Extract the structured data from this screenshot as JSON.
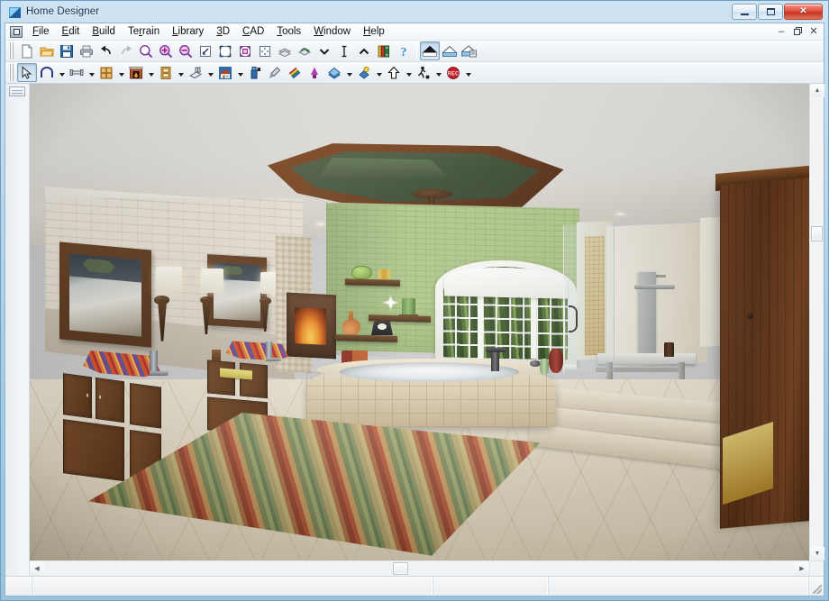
{
  "window": {
    "title": "Home Designer",
    "app_icon": "app-logo-icon",
    "controls": {
      "minimize": "–",
      "maximize": "❑",
      "close": "✕"
    },
    "mdi_controls": {
      "minimize": "–",
      "restore": "❐",
      "close": "✕"
    }
  },
  "menubar": {
    "system_icon": "system-menu-icon",
    "items": [
      {
        "label": "File",
        "accel": "F"
      },
      {
        "label": "Edit",
        "accel": "E"
      },
      {
        "label": "Build",
        "accel": "B"
      },
      {
        "label": "Terrain",
        "accel": "r"
      },
      {
        "label": "Library",
        "accel": "L"
      },
      {
        "label": "3D",
        "accel": "3"
      },
      {
        "label": "CAD",
        "accel": "C"
      },
      {
        "label": "Tools",
        "accel": "T"
      },
      {
        "label": "Window",
        "accel": "W"
      },
      {
        "label": "Help",
        "accel": "H"
      }
    ]
  },
  "toolbar_standard": {
    "name": "Standard Toolbar",
    "buttons": [
      {
        "icon": "new-plan-icon",
        "label": "New Plan",
        "pressed": false
      },
      {
        "icon": "open-plan-icon",
        "label": "Open Plan",
        "pressed": false
      },
      {
        "icon": "save-icon",
        "label": "Save Plan",
        "pressed": false
      },
      {
        "icon": "print-icon",
        "label": "Print",
        "pressed": false
      },
      {
        "icon": "undo-icon",
        "label": "Undo",
        "pressed": false
      },
      {
        "icon": "redo-icon",
        "label": "Redo",
        "pressed": false
      },
      {
        "icon": "zoom-icon",
        "label": "Zoom",
        "pressed": false
      },
      {
        "icon": "zoom-in-icon",
        "label": "Zoom In",
        "pressed": false
      },
      {
        "icon": "zoom-out-icon",
        "label": "Zoom Out",
        "pressed": false
      },
      {
        "icon": "fill-window-icon",
        "label": "Fill Window",
        "pressed": false
      },
      {
        "icon": "fill-window-building-icon",
        "label": "Fill Window Building Only",
        "pressed": false
      },
      {
        "icon": "zoom-window-icon",
        "label": "Zoom Window",
        "pressed": false
      },
      {
        "icon": "pan-window-icon",
        "label": "Pan Window",
        "pressed": false
      },
      {
        "icon": "floor-down-icon",
        "label": "Down One Floor",
        "pressed": false
      },
      {
        "icon": "reference-floor-icon",
        "label": "Reference Display",
        "pressed": false
      },
      {
        "icon": "floor-select-icon",
        "label": "Select Floor",
        "pressed": false
      },
      {
        "icon": "floor-level-icon",
        "label": "Floor Level",
        "pressed": false
      },
      {
        "icon": "floor-up-icon",
        "label": "Up One Floor",
        "pressed": false
      },
      {
        "icon": "library-browser-icon",
        "label": "Library Browser",
        "pressed": false
      },
      {
        "icon": "help-icon",
        "label": "Help",
        "pressed": false
      },
      {
        "icon": "full-camera-icon",
        "label": "Full Camera",
        "pressed": true
      },
      {
        "icon": "elevation-camera-icon",
        "label": "Full Overview",
        "pressed": false
      },
      {
        "icon": "doll-house-view-icon",
        "label": "Doll House View",
        "pressed": false
      }
    ]
  },
  "toolbar_tools": {
    "name": "Tools Toolbar",
    "buttons": [
      {
        "icon": "select-objects-icon",
        "label": "Select Objects",
        "pressed": true,
        "dropdown": false
      },
      {
        "icon": "wall-tools-icon",
        "label": "Wall Tools",
        "pressed": false,
        "dropdown": true
      },
      {
        "icon": "railing-tools-icon",
        "label": "Railing Tools",
        "pressed": false,
        "dropdown": true
      },
      {
        "icon": "cabinet-tools-icon",
        "label": "Cabinet Tools",
        "pressed": false,
        "dropdown": true
      },
      {
        "icon": "fireplace-tools-icon",
        "label": "Fireplace Tools",
        "pressed": false,
        "dropdown": true
      },
      {
        "icon": "door-tools-icon",
        "label": "Door Tools",
        "pressed": false,
        "dropdown": true
      },
      {
        "icon": "window-tools-icon",
        "label": "Window Tools",
        "pressed": false,
        "dropdown": true
      },
      {
        "icon": "roof-tools-icon",
        "label": "Roof Tools",
        "pressed": false,
        "dropdown": true
      },
      {
        "icon": "material-paint-icon",
        "label": "Material Painter",
        "pressed": false,
        "dropdown": false
      },
      {
        "icon": "eyedropper-icon",
        "label": "Eyedropper",
        "pressed": false,
        "dropdown": false
      },
      {
        "icon": "material-list-icon",
        "label": "Materials List",
        "pressed": false,
        "dropdown": false
      },
      {
        "icon": "plant-tools-icon",
        "label": "Plant Tools",
        "pressed": false,
        "dropdown": false
      },
      {
        "icon": "terrain-tools-icon",
        "label": "Terrain Tools",
        "pressed": false,
        "dropdown": true
      },
      {
        "icon": "light-tools-icon",
        "label": "Light Tools",
        "pressed": false,
        "dropdown": true
      },
      {
        "icon": "arrow-up-icon",
        "label": "Move Up",
        "pressed": false,
        "dropdown": true
      },
      {
        "icon": "walkthrough-icon",
        "label": "Walkthrough",
        "pressed": false,
        "dropdown": true
      },
      {
        "icon": "record-walkthrough-icon",
        "label": "Record Walkthrough",
        "pressed": false,
        "dropdown": true
      }
    ]
  },
  "document_view": {
    "name": "3d-camera-view",
    "scene": {
      "description": "Rendered 3D interior perspective of a master bathroom",
      "ceiling": {
        "type": "octagonal tray ceiling",
        "trim_color": "#6b4526",
        "recess_color": "#4e5f43",
        "fixture": "wicker ceiling fan",
        "can_lights": 5
      },
      "left_wall": {
        "finish": "white painted brick",
        "color": "#eae3d6",
        "mirrors": 2,
        "sconces": 3
      },
      "back_wall": {
        "finish": "green painted brick",
        "color": "#aec787",
        "floating_shelves": 3,
        "shelf_objects": [
          "green plate",
          "gold candles",
          "orange gourd vase",
          "mantel clock",
          "green canister",
          "starburst"
        ]
      },
      "window": {
        "type": "arched transom over 3-lite sliding window",
        "frame_color": "#ffffff",
        "view": "forest / trees"
      },
      "tub": {
        "type": "drop-in corner soaking tub",
        "surround": "travertine tile",
        "surround_color": "#e3d5b8",
        "faucet": "oil-rubbed bronze"
      },
      "vanities": {
        "count": 2,
        "cabinet_color": "#5a3519",
        "countertop_color": "#e3ddd0",
        "sinks": "colorful art-glass vessel sinks"
      },
      "shower": {
        "enclosure": "frameless glass",
        "panel": "stainless shower tower",
        "bench": "floating stone bench",
        "accent": "gold mosaic tile strip"
      },
      "floor": {
        "material": "beige diagonal tile",
        "color": "#e6dcc7",
        "steps": 3
      },
      "rug": {
        "pattern": "multicolor horizontal stripes",
        "colors": [
          "#6d8450",
          "#c2ad6c",
          "#d8bf79",
          "#9e3c23",
          "#c2512a",
          "#d8a05a"
        ]
      },
      "door": {
        "position": "right",
        "material": "dark stained wood plank",
        "color": "#5d3217"
      },
      "fireplace": {
        "present": true,
        "firebox_color": "#3f2512"
      }
    }
  },
  "scrollbars": {
    "vertical": {
      "up_arrow": "▲",
      "down_arrow": "▼",
      "thumb_position_pct": 30
    },
    "horizontal": {
      "left_arrow": "◀",
      "right_arrow": "▶",
      "thumb_position_pct": 49
    }
  },
  "statusbar": {
    "panes": [
      "",
      "",
      "",
      ""
    ],
    "resize_grip": "resize-grip-icon"
  }
}
